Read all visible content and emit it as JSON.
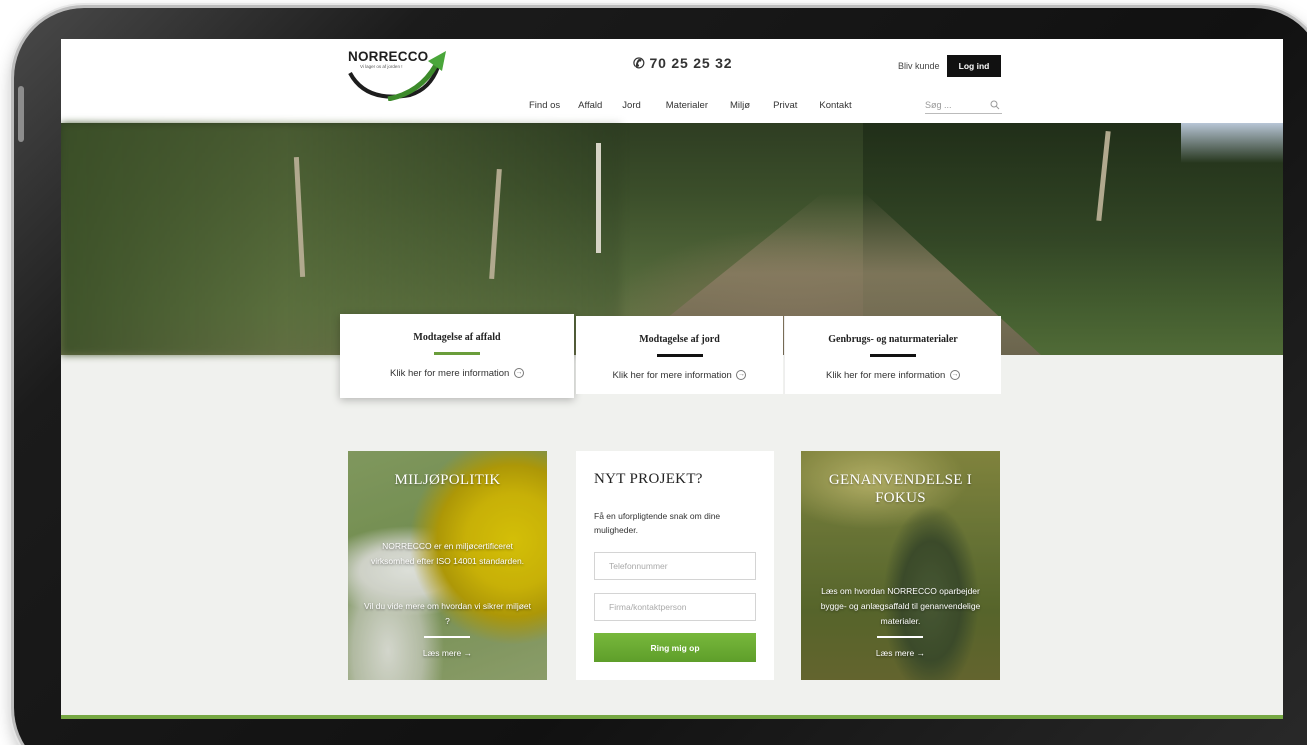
{
  "header": {
    "logo": {
      "name": "NORRECCO",
      "tagline": "Vi lager os af jorden !"
    },
    "phone": "70 25 25 32",
    "become_customer": "Bliv kunde",
    "login_label": "Log ind",
    "nav": [
      "Find os",
      "Affald",
      "Jord",
      "Materialer",
      "Miljø",
      "Privat",
      "Kontakt"
    ],
    "search_placeholder": "Søg ..."
  },
  "services": [
    {
      "title": "Modtagelse af affald",
      "link": "Klik her for mere information",
      "active": true
    },
    {
      "title": "Modtagelse af jord",
      "link": "Klik her for mere information",
      "active": false
    },
    {
      "title": "Genbrugs- og naturmaterialer",
      "link": "Klik her for mere information",
      "active": false
    }
  ],
  "cards": {
    "policy": {
      "title": "MILJØPOLITIK",
      "text1": "NORRECCO er en miljøcertificeret virksomhed efter ISO 14001 standarden.",
      "text2": "Vil du vide mere om hvordan vi sikrer miljøet ?",
      "link": "Læs mere"
    },
    "project": {
      "title": "NYT PROJEKT?",
      "text": "Få en uforpligtende snak om dine muligheder.",
      "phone_placeholder": "Telefonnummer",
      "company_placeholder": "Firma/kontaktperson",
      "button": "Ring mig op"
    },
    "recycling": {
      "title": "GENANVENDELSE I FOKUS",
      "text": "Læs om hvordan NORRECCO oparbejder bygge- og anlægsaffald til genanvendelige materialer.",
      "link": "Læs mere"
    }
  },
  "colors": {
    "accent_green": "#6a9d3b",
    "button_green": "#6aab33",
    "dark": "#111111"
  }
}
